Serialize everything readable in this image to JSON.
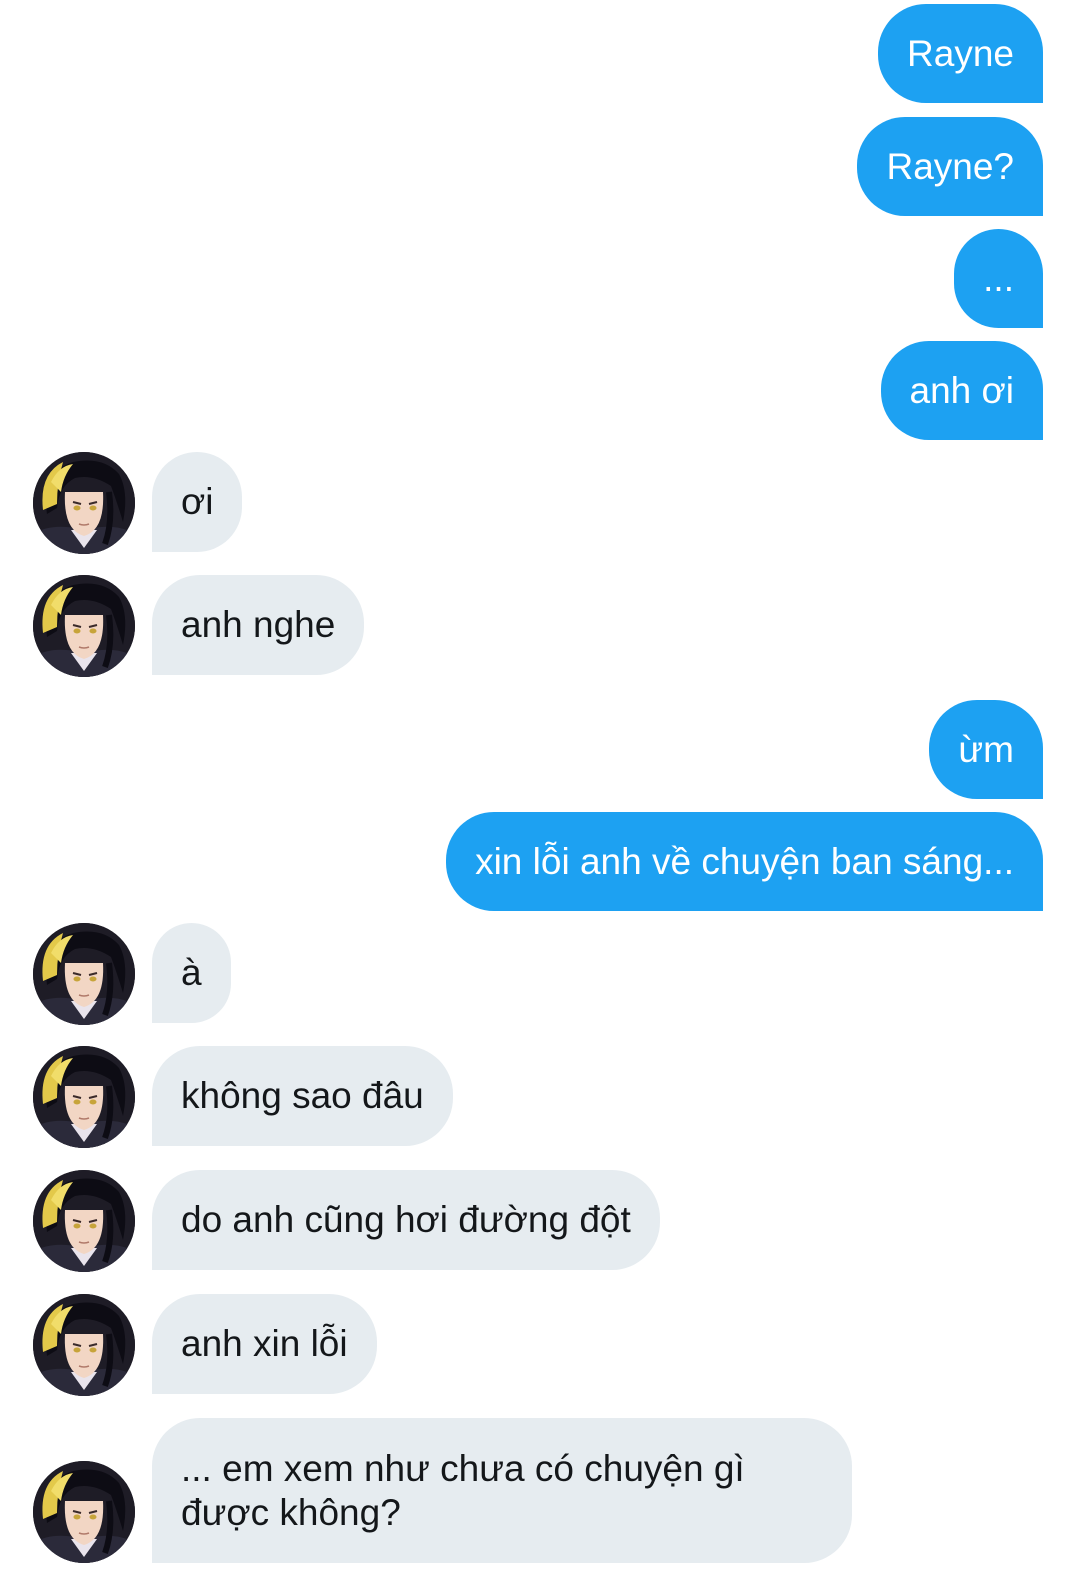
{
  "conversation": {
    "messages": [
      {
        "from": "me",
        "text": "Rayne"
      },
      {
        "from": "me",
        "text": "Rayne?"
      },
      {
        "from": "me",
        "text": "..."
      },
      {
        "from": "me",
        "text": "anh ơi"
      },
      {
        "from": "them",
        "text": "ơi"
      },
      {
        "from": "them",
        "text": "anh nghe"
      },
      {
        "from": "me",
        "text": "ừm"
      },
      {
        "from": "me",
        "text": "xin lỗi anh về chuyện ban sáng..."
      },
      {
        "from": "them",
        "text": "à"
      },
      {
        "from": "them",
        "text": "không sao đâu"
      },
      {
        "from": "them",
        "text": "do anh cũng hơi đường đột"
      },
      {
        "from": "them",
        "text": "anh xin lỗi"
      },
      {
        "from": "them",
        "text": "... em xem như chưa có chuyện gì được không?"
      }
    ]
  },
  "colors": {
    "sent_bubble": "#1da1f2",
    "received_bubble": "#e6ecf0",
    "received_text": "#14171a",
    "background": "#ffffff"
  },
  "contact": {
    "avatar_icon": "anime-character-avatar"
  }
}
